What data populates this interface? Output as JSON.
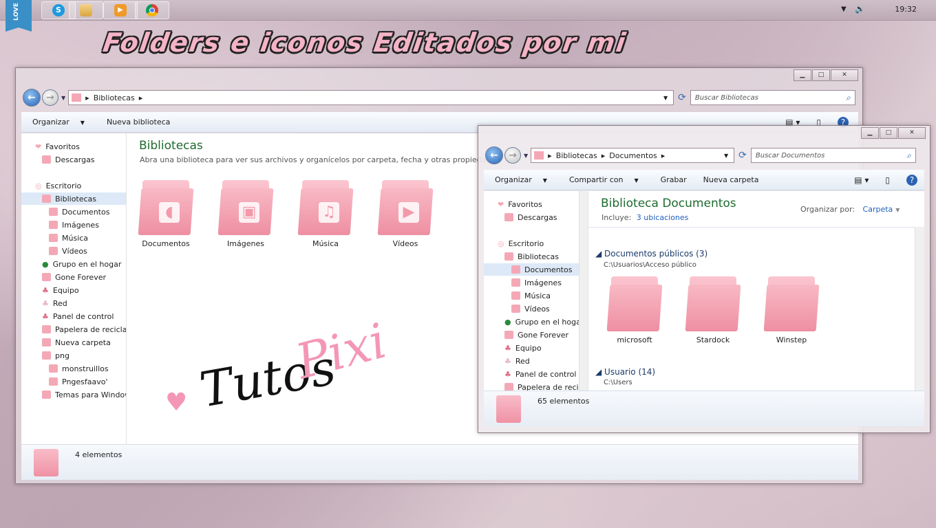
{
  "taskbar": {
    "badge": "LOVE",
    "clock": "19:32",
    "apps": [
      "skype-icon",
      "explorer-icon",
      "media-player-icon",
      "chrome-icon"
    ]
  },
  "banner": "Folders e iconos Editados por mi",
  "watermark": {
    "part1": "Tutos",
    "part2": "Pixi"
  },
  "win1": {
    "title_buttons": [
      "▁",
      "□",
      "✕"
    ],
    "breadcrumb": "Bibliotecas",
    "search_placeholder": "Buscar Bibliotecas",
    "toolbar": {
      "organize": "Organizar",
      "new_library": "Nueva biblioteca"
    },
    "nav": [
      "Favoritos",
      "Descargas",
      "Escritorio",
      "Bibliotecas",
      "Documentos",
      "Imágenes",
      "Música",
      "Vídeos",
      "Grupo en el hogar",
      "Gone Forever",
      "Equipo",
      "Red",
      "Panel de control",
      "Papelera de reciclaje",
      "Nueva carpeta",
      "png",
      "monstruillos",
      "Pngesfaavo'",
      "Temas para Windows"
    ],
    "heading": "Bibliotecas",
    "subheading": "Abra una biblioteca para ver sus archivos y organícelos por carpeta, fecha y otras propiedades.",
    "folders": [
      {
        "label": "Documentos",
        "glyph": "◖"
      },
      {
        "label": "Imágenes",
        "glyph": "▣"
      },
      {
        "label": "Música",
        "glyph": "♫"
      },
      {
        "label": "Vídeos",
        "glyph": "▶"
      }
    ],
    "status": "4 elementos"
  },
  "win2": {
    "title_buttons": [
      "▁",
      "□",
      "✕"
    ],
    "breadcrumb": [
      "Bibliotecas",
      "Documentos"
    ],
    "search_placeholder": "Buscar Documentos",
    "toolbar": {
      "organize": "Organizar",
      "share": "Compartir con",
      "burn": "Grabar",
      "new_folder": "Nueva carpeta"
    },
    "nav": [
      "Favoritos",
      "Descargas",
      "Escritorio",
      "Bibliotecas",
      "Documentos",
      "Imágenes",
      "Música",
      "Vídeos",
      "Grupo en el hogar",
      "Gone Forever",
      "Equipo",
      "Red",
      "Panel de control",
      "Papelera de reciclaje"
    ],
    "heading": "Biblioteca Documentos",
    "includes_label": "Incluye:",
    "includes_link": "3 ubicaciones",
    "arrange_label": "Organizar por:",
    "arrange_value": "Carpeta",
    "group1": {
      "title": "Documentos públicos (3)",
      "path": "C:\\Usuarios\\Acceso público",
      "items": [
        "microsoft",
        "Stardock",
        "Winstep"
      ]
    },
    "group2": {
      "title": "Usuario (14)",
      "path": "C:\\Users"
    },
    "status": "65 elementos"
  }
}
